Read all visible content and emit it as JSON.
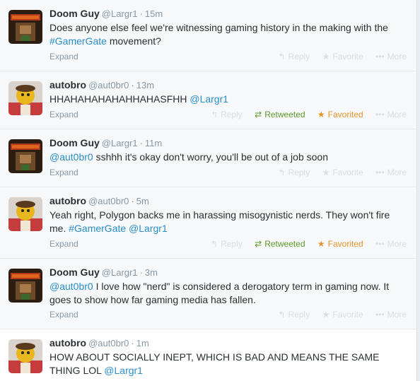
{
  "tweets": [
    {
      "name": "Doom Guy",
      "handle": "@Largr1",
      "time": "15m",
      "text_parts": [
        "Does anyone else feel we're witnessing gaming history in the making with the ",
        "#GamerGate",
        " movement?"
      ],
      "expand": "Expand",
      "reply": "Reply",
      "retweet": "",
      "favorite": "Favorite",
      "more": "More"
    },
    {
      "name": "autobro",
      "handle": "@aut0br0",
      "time": "13m",
      "text_parts": [
        "HHAHAHAHAHAHHAHASFHH ",
        "@Largr1",
        ""
      ],
      "expand": "Expand",
      "reply": "Reply",
      "retweet": "Retweeted",
      "favorite": "Favorited",
      "more": "More"
    },
    {
      "name": "Doom Guy",
      "handle": "@Largr1",
      "time": "11m",
      "text_parts": [
        "",
        "@aut0br0",
        " sshhh it's okay don't worry, you'll be out of a job soon"
      ],
      "expand": "Expand",
      "reply": "Reply",
      "retweet": "",
      "favorite": "Favorite",
      "more": "More"
    },
    {
      "name": "autobro",
      "handle": "@aut0br0",
      "time": "5m",
      "text_parts": [
        "Yeah right, Polygon backs me in harassing misogynistic nerds. They won't fire me. ",
        "#GamerGate @Largr1",
        ""
      ],
      "expand": "Expand",
      "reply": "Reply",
      "retweet": "Retweeted",
      "favorite": "Favorited",
      "more": "More"
    },
    {
      "name": "Doom Guy",
      "handle": "@Largr1",
      "time": "3m",
      "text_parts": [
        "",
        "@aut0br0",
        " I love how \"nerd\" is considered a derogatory term in gaming now. It goes to show how far gaming media has fallen."
      ],
      "expand": "Expand",
      "reply": "Reply",
      "retweet": "",
      "favorite": "Favorite",
      "more": "More"
    },
    {
      "name": "autobro",
      "handle": "@aut0br0",
      "time": "1m",
      "text_parts": [
        "HOW ABOUT SOCIALLY INEPT, WHICH IS BAD AND MEANS THE SAME THING LOL ",
        "@Largr1",
        ""
      ]
    }
  ],
  "colors": {
    "link": "#2a8ec9",
    "retweeted": "#609928",
    "favorited": "#e5952b",
    "muted": "#8899a6"
  },
  "icons": {
    "reply": "reply-icon",
    "retweet": "retweet-icon",
    "favorite": "star-icon",
    "more": "more-icon"
  }
}
